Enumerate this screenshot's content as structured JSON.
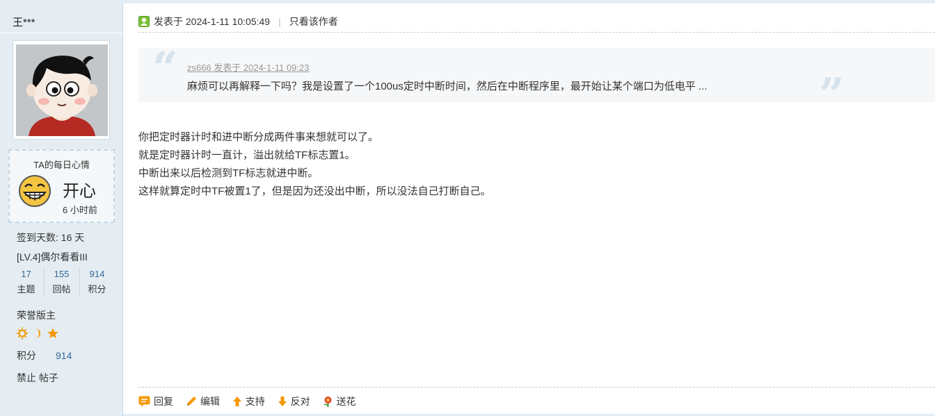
{
  "user": {
    "name": "王***",
    "mood_title": "TA的每日心情",
    "mood_text": "开心",
    "mood_time": "6 小时前",
    "checkin": "签到天数: 16 天",
    "level": "[LV.4]偶尔看看III",
    "stats": [
      {
        "value": "17",
        "label": "主题"
      },
      {
        "value": "155",
        "label": "回帖"
      },
      {
        "value": "914",
        "label": "积分"
      }
    ],
    "title": "荣誉版主",
    "medals": [
      "sun-icon",
      "moon-icon",
      "star-icon"
    ],
    "credits_label": "积分",
    "credits_value": "914",
    "status": "禁止 帖子"
  },
  "post": {
    "posted_at": "发表于 2024-1-11 10:05:49",
    "author_only": "只看该作者",
    "quote": {
      "meta": "zs666 发表于 2024-1-11 09:23",
      "text": "麻烦可以再解释一下吗？我是设置了一个100us定时中断时间，然后在中断程序里，最开始让某个端口为低电平 ..."
    },
    "lines": [
      "你把定时器计时和进中断分成两件事来想就可以了。",
      "就是定时器计时一直计，溢出就给TF标志置1。",
      "中断出来以后检测到TF标志就进中断。",
      "这样就算定时中TF被置1了，但是因为还没出中断，所以没法自己打断自己。"
    ]
  },
  "actions": {
    "reply": "回复",
    "edit": "编辑",
    "support": "支持",
    "oppose": "反对",
    "flower": "送花"
  },
  "colors": {
    "sidebar_bg": "#e5edf2",
    "link_blue": "#336699",
    "medal_orange": "#f39800"
  }
}
